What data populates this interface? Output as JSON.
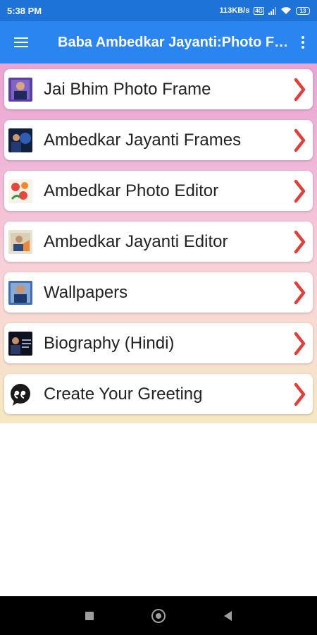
{
  "status": {
    "time": "5:38 PM",
    "net_speed": "113KB/s",
    "lte_badge": "4G",
    "battery": "13"
  },
  "app": {
    "title": "Baba Ambedkar Jayanti:Photo Frame"
  },
  "menu": {
    "items": [
      {
        "label": "Jai Bhim Photo Frame"
      },
      {
        "label": "Ambedkar Jayanti Frames"
      },
      {
        "label": "Ambedkar Photo Editor"
      },
      {
        "label": "Ambedkar Jayanti Editor"
      },
      {
        "label": "Wallpapers"
      },
      {
        "label": "Biography (Hindi)"
      },
      {
        "label": "Create Your Greeting"
      }
    ]
  },
  "colors": {
    "statusbar": "#1e73d8",
    "appbar": "#2a85f0",
    "chevron": "#e0403a"
  }
}
